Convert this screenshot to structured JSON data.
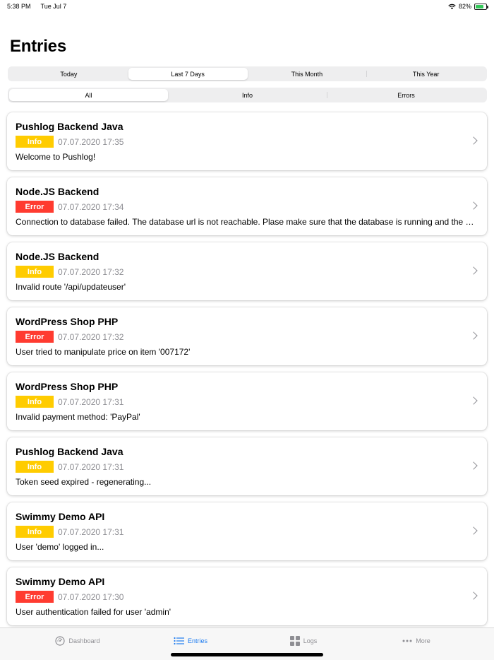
{
  "status_bar": {
    "time": "5:38 PM",
    "date": "Tue Jul 7",
    "battery": "82%",
    "battery_level": 0.82
  },
  "page": {
    "title": "Entries"
  },
  "range_filter": {
    "options": [
      "Today",
      "Last 7 Days",
      "This Month",
      "This Year"
    ],
    "selected": "Last 7 Days"
  },
  "type_filter": {
    "options": [
      "All",
      "Info",
      "Errors"
    ],
    "selected": "All"
  },
  "colors": {
    "info": "#ffcc00",
    "error": "#ff3b30",
    "accent": "#1e7cf0"
  },
  "entries": [
    {
      "title": "Pushlog Backend Java",
      "level": "Info",
      "time": "07.07.2020 17:35",
      "message": "Welcome to Pushlog!"
    },
    {
      "title": "Node.JS Backend",
      "level": "Error",
      "time": "07.07.2020 17:34",
      "message": "Connection to database failed. The database url is not reachable. Plase make sure that the database is running and the url is correct."
    },
    {
      "title": "Node.JS Backend",
      "level": "Info",
      "time": "07.07.2020 17:32",
      "message": "Invalid route '/api/updateuser'"
    },
    {
      "title": "WordPress Shop PHP",
      "level": "Error",
      "time": "07.07.2020 17:32",
      "message": "User tried to manipulate price on item '007172'"
    },
    {
      "title": "WordPress Shop PHP",
      "level": "Info",
      "time": "07.07.2020 17:31",
      "message": "Invalid payment method: 'PayPal'"
    },
    {
      "title": "Pushlog Backend Java",
      "level": "Info",
      "time": "07.07.2020 17:31",
      "message": "Token seed expired - regenerating..."
    },
    {
      "title": "Swimmy Demo API",
      "level": "Info",
      "time": "07.07.2020 17:31",
      "message": "User 'demo' logged in..."
    },
    {
      "title": "Swimmy Demo API",
      "level": "Error",
      "time": "07.07.2020 17:30",
      "message": "User authentication failed for user 'admin'"
    }
  ],
  "tab_bar": {
    "tabs": [
      {
        "label": "Dashboard",
        "icon": "dashboard-icon"
      },
      {
        "label": "Entries",
        "icon": "list-icon"
      },
      {
        "label": "Logs",
        "icon": "grid-icon"
      },
      {
        "label": "More",
        "icon": "more-icon"
      }
    ],
    "selected": "Entries"
  }
}
